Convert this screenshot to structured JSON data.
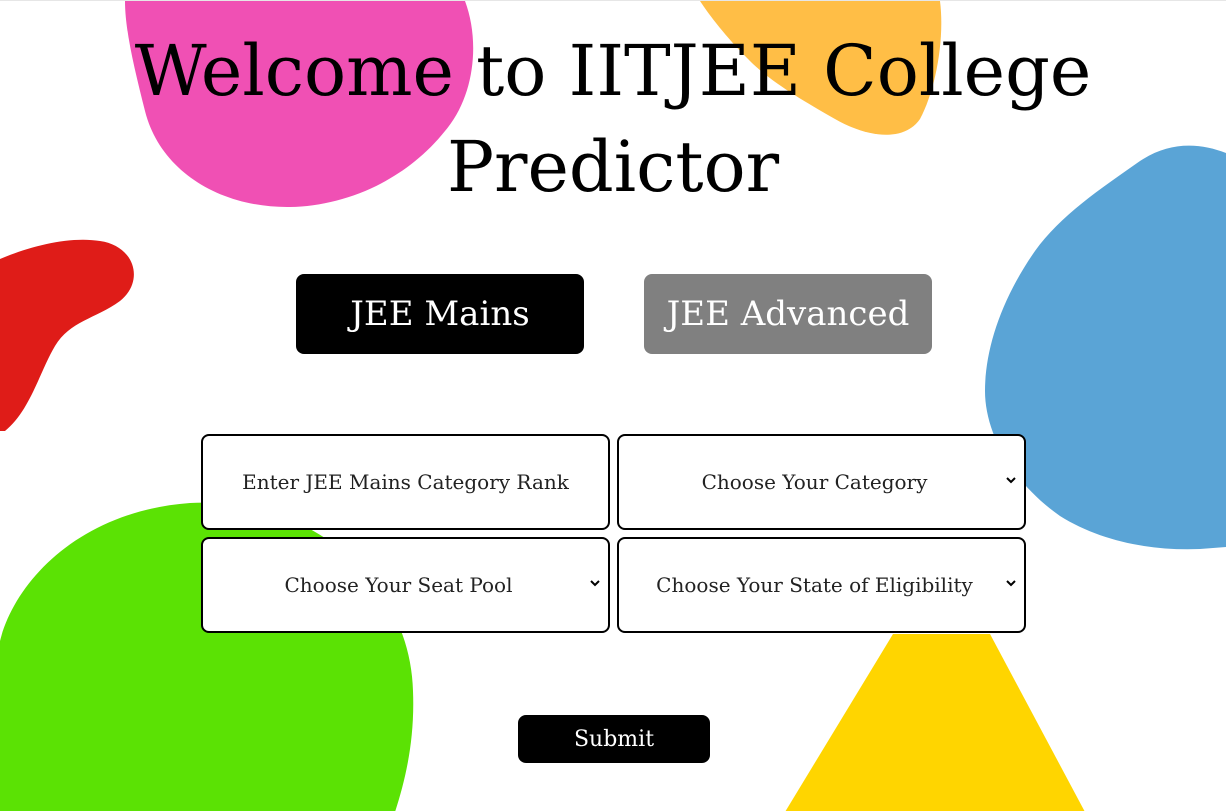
{
  "header": {
    "title_line1": "Welcome to IITJEE College",
    "title_line2": "Predictor"
  },
  "exam_tabs": {
    "mains_label": "JEE Mains",
    "advanced_label": "JEE Advanced"
  },
  "form": {
    "rank_placeholder": "Enter JEE Mains Category Rank",
    "category_select": "Choose Your Category",
    "seat_pool_select": "Choose Your Seat Pool",
    "state_select": "Choose Your State of Eligibility",
    "submit_label": "Submit"
  },
  "colors": {
    "active_tab": "#000000",
    "inactive_tab": "#808080",
    "blob_pink": "#f050b4",
    "blob_orange": "#ffbe46",
    "blob_red": "#df1c18",
    "blob_blue": "#5aa4d6",
    "blob_green": "#5be204",
    "blob_yellow": "#ffd500"
  }
}
